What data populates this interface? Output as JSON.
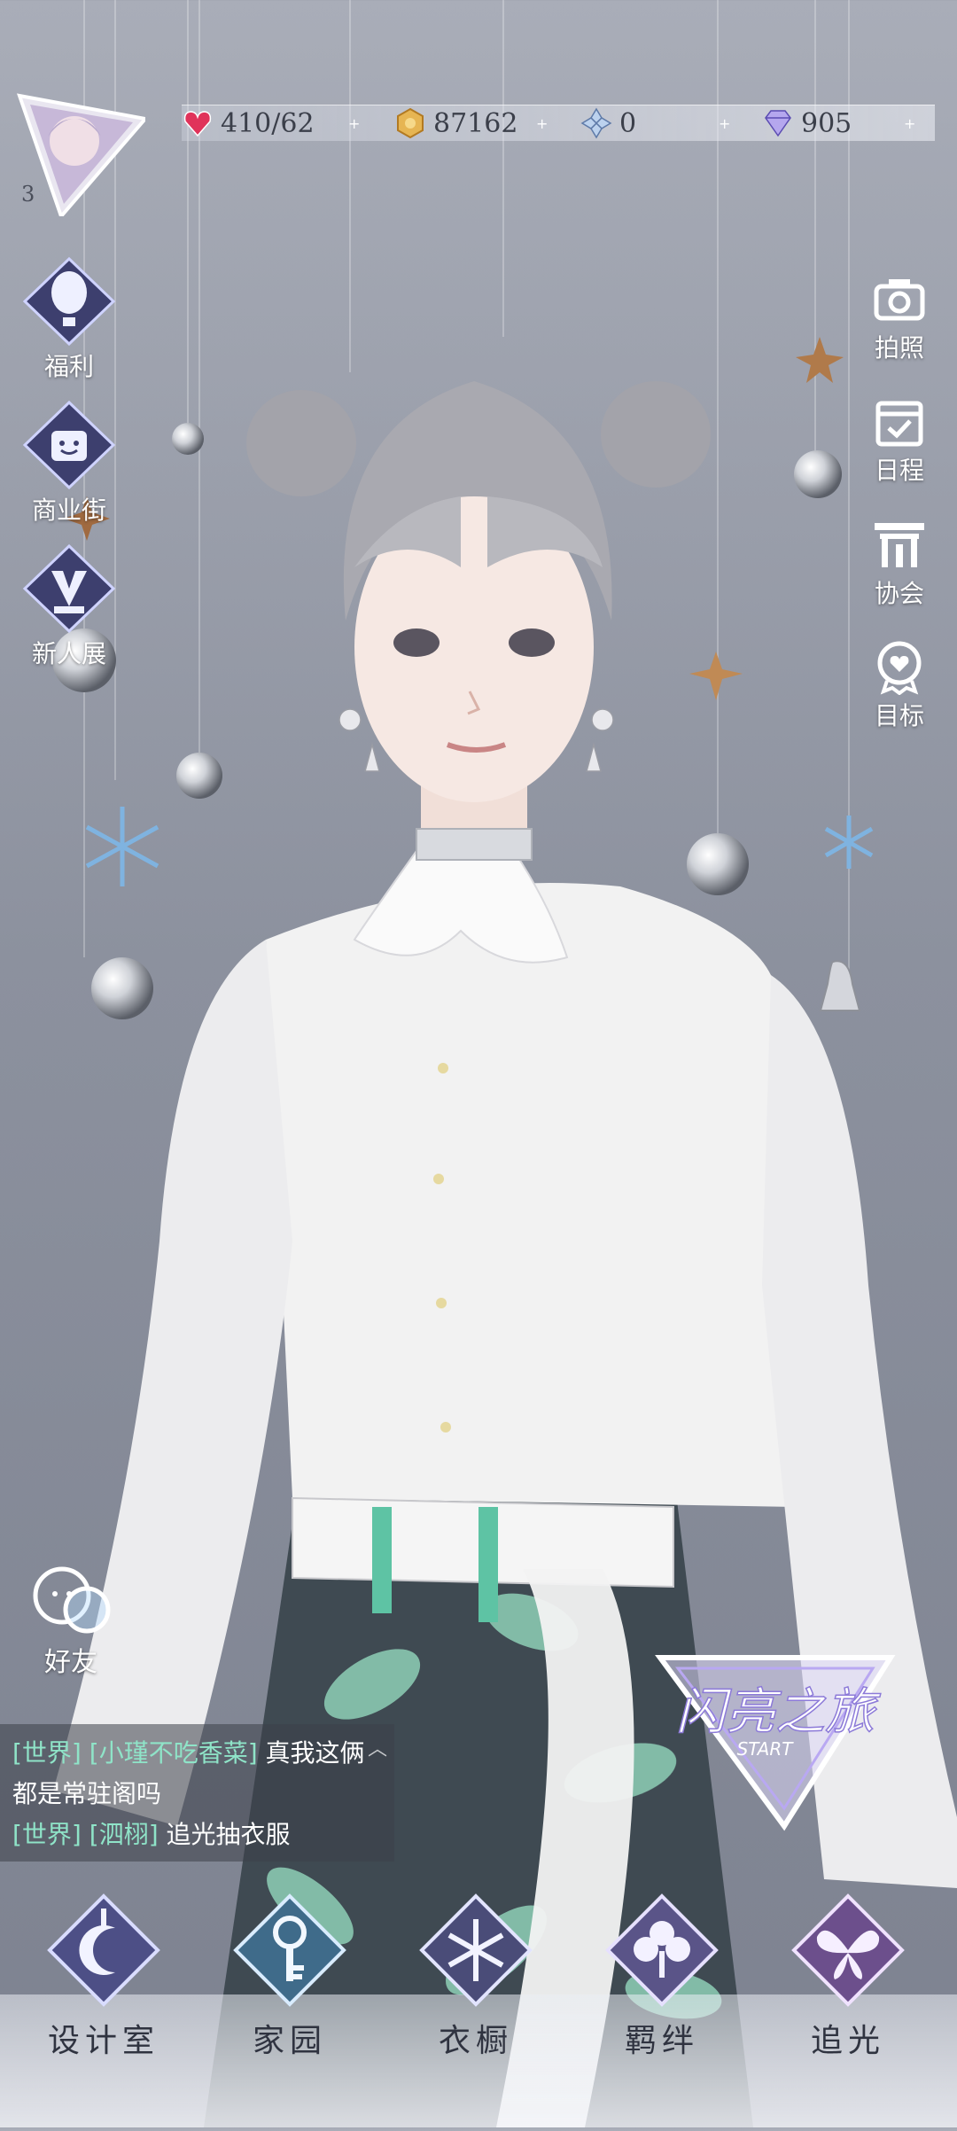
{
  "resources": [
    {
      "icon": "heart-stamina-icon",
      "value": "410/62"
    },
    {
      "icon": "gold-coin-icon",
      "value": "87162"
    },
    {
      "icon": "crystal-flower-icon",
      "value": "0"
    },
    {
      "icon": "diamond-icon",
      "value": "905"
    }
  ],
  "player": {
    "level": "3"
  },
  "left_menu": [
    {
      "icon": "balloon-icon",
      "label": "福利"
    },
    {
      "icon": "shopping-bag-icon",
      "label": "商业街"
    },
    {
      "icon": "trophy-icon",
      "label": "新人展"
    }
  ],
  "right_menu": [
    {
      "icon": "camera-icon",
      "label": "拍照"
    },
    {
      "icon": "calendar-check-icon",
      "label": "日程"
    },
    {
      "icon": "gate-icon",
      "label": "协会"
    },
    {
      "icon": "target-badge-icon",
      "label": "目标"
    }
  ],
  "friends": {
    "label": "好友"
  },
  "chat": [
    {
      "channel": "[世界]",
      "nick": "[小瑾不吃香菜]",
      "line1": "真我这俩",
      "line2": "都是常驻阁吗"
    },
    {
      "channel": "[世界]",
      "nick": "[泗栩]",
      "line1": "追光抽衣服"
    }
  ],
  "journey": {
    "title": "闪亮之旅",
    "sub": "START"
  },
  "bottom_nav": [
    {
      "icon": "moon-pen-icon",
      "label": "设计室"
    },
    {
      "icon": "key-icon",
      "label": "家园"
    },
    {
      "icon": "snowflake-gem-icon",
      "label": "衣橱"
    },
    {
      "icon": "clover-icon",
      "label": "羁绊"
    },
    {
      "icon": "butterfly-icon",
      "label": "追光"
    }
  ],
  "colors": {
    "accent_green": "#356b55",
    "chat_green": "#8fe4c8",
    "ruby": "#e0335a"
  }
}
